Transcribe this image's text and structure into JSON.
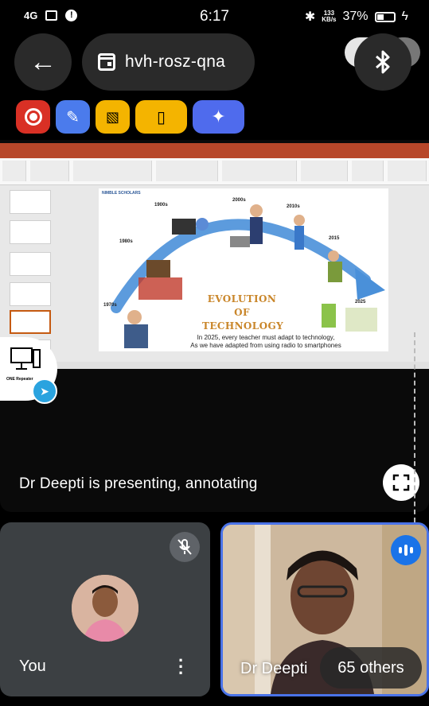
{
  "status_bar": {
    "network": "4G",
    "time": "6:17",
    "net_speed_value": "133",
    "net_speed_unit": "KB/s",
    "battery": "37%"
  },
  "top_bar": {
    "meeting_code": "hvh-rosz-qna"
  },
  "toolbar": {
    "icons": [
      "record-icon",
      "pen-icon",
      "gallery-off-icon",
      "breakout-door-icon",
      "sparkle-icon"
    ],
    "colors": {
      "record": "#d93025",
      "pen": "#4b7bec",
      "yellow": "#f4b400",
      "sparkle": "#4f6bed"
    }
  },
  "slide": {
    "brand": "NIMBLE SCHOLARS",
    "years": [
      "1900s",
      "2000s",
      "2010s",
      "1980s",
      "2015",
      "1970s",
      "2025"
    ],
    "headline_line1": "EVOLUTION OF",
    "headline_line2": "TECHNOLOGY",
    "caption_line1": "In 2025, every teacher must adapt to technology,",
    "caption_line2": "As we have adapted from using radio to smartphones"
  },
  "app_badge": {
    "label": "ONE Repeater"
  },
  "presentation": {
    "status_text": "Dr Deepti is presenting, annotating"
  },
  "tiles": {
    "self_name": "You",
    "speaker_name": "Dr Deepti",
    "others_label": "65 others"
  }
}
